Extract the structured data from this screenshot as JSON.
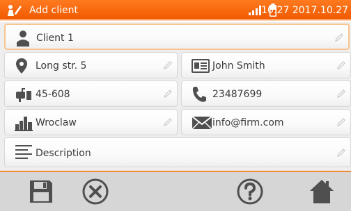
{
  "statusbar": {
    "title": "Add client",
    "time": "10:27 2017.10.27",
    "icons": [
      "app-logo-icon",
      "signal-icon",
      "battery-icon"
    ]
  },
  "client": {
    "name": "Client 1",
    "street": "Long str. 5",
    "contact": "John Smith",
    "postcode": "45-608",
    "phone": "23487699",
    "city": "Wroclaw",
    "email": "info@firm.com",
    "description": "Description"
  },
  "toolbar": {
    "buttons": [
      "save-icon",
      "cancel-icon",
      "help-icon",
      "home-icon"
    ]
  },
  "colors": {
    "accent": "#f15a00",
    "icon": "#4f4f4f",
    "toolbar": "#d6d6d6"
  }
}
